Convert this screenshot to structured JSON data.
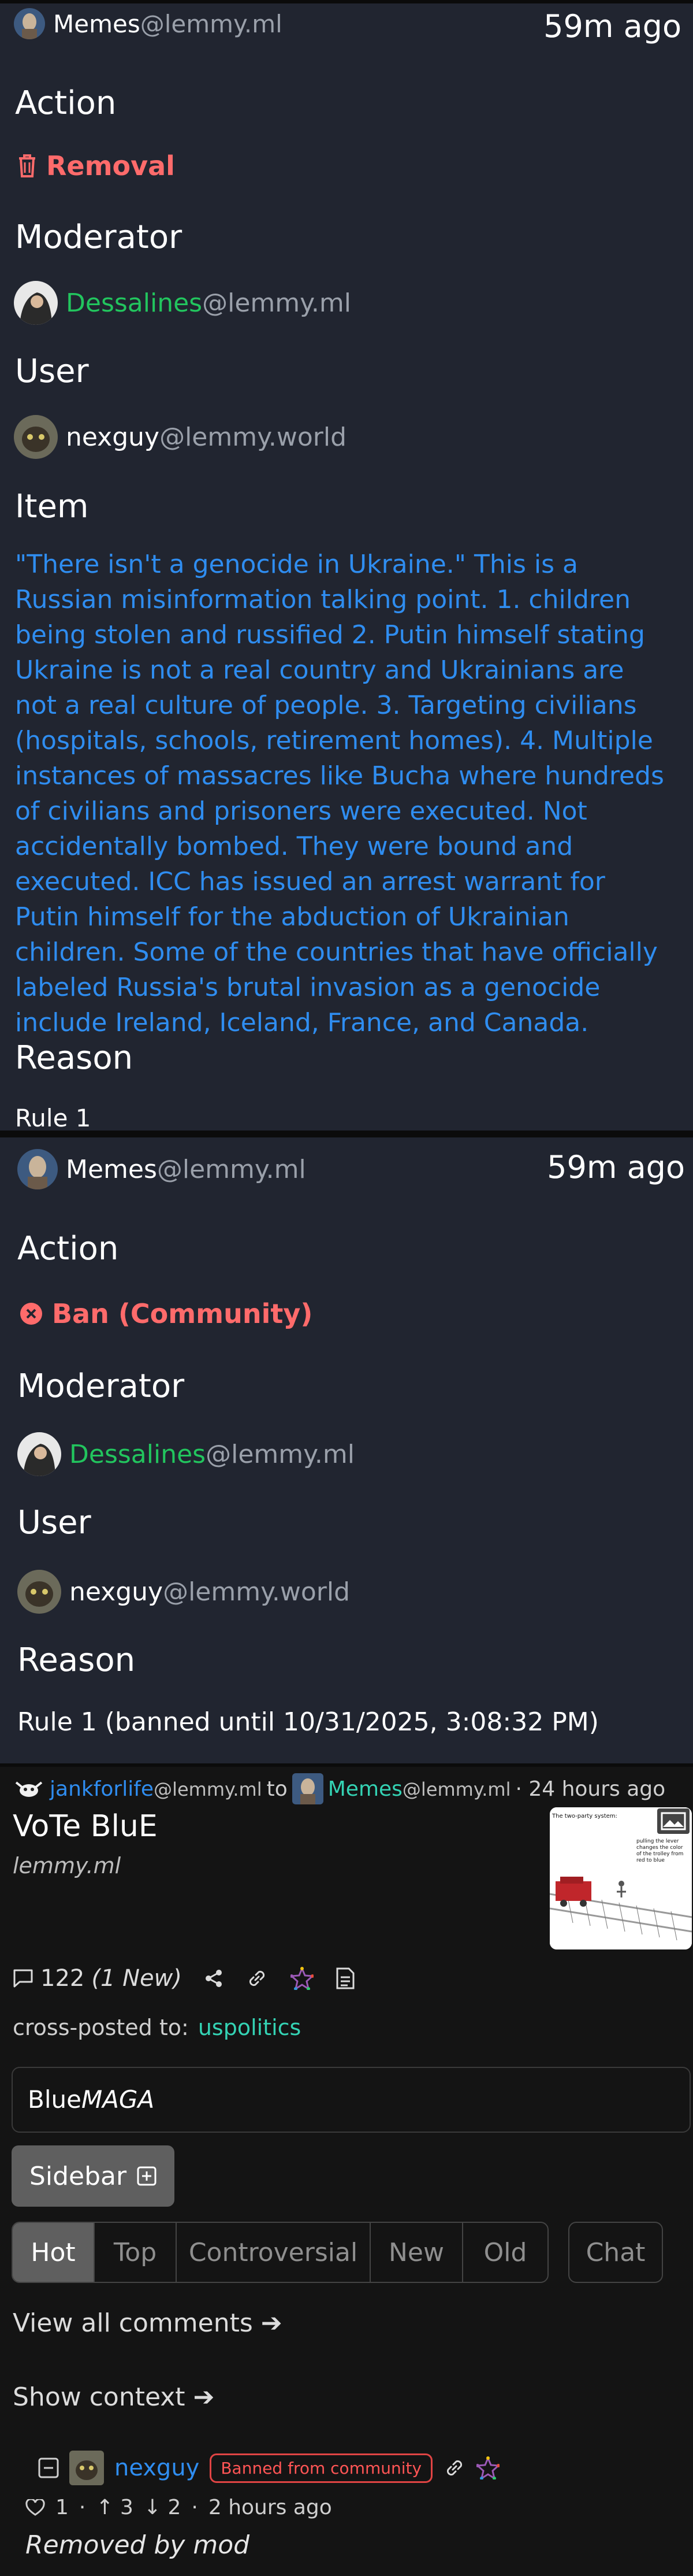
{
  "log_entry_1": {
    "community_name": "Memes",
    "community_instance": "@lemmy.ml",
    "time": "59m ago",
    "action_heading": "Action",
    "action": "Removal",
    "moderator_heading": "Moderator",
    "moderator_name": "Dessalines",
    "moderator_instance": "@lemmy.ml",
    "user_heading": "User",
    "user_name": "nexguy",
    "user_instance": "@lemmy.world",
    "item_heading": "Item",
    "item_text": "\"There isn't a genocide in Ukraine.\" This is a Russian misinformation talking point. 1. children being stolen and russified 2. Putin himself stating Ukraine is not a real country and Ukrainians are not a real culture of people. 3. Targeting civilians (hospitals, schools, retirement homes). 4. Multiple instances of massacres like Bucha where hundreds of civilians and prisoners were executed. Not accidentally bombed. They were bound and executed. ICC has issued an arrest warrant for Putin himself for the abduction of Ukrainian children. Some of the countries that have officially labeled Russia's brutal invasion as a genocide include Ireland, Iceland, France, and Canada.",
    "reason_heading": "Reason",
    "reason": "Rule 1"
  },
  "log_entry_2": {
    "community_name": "Memes",
    "community_instance": "@lemmy.ml",
    "time": "59m ago",
    "action_heading": "Action",
    "action": "Ban (Community)",
    "moderator_heading": "Moderator",
    "moderator_name": "Dessalines",
    "moderator_instance": "@lemmy.ml",
    "user_heading": "User",
    "user_name": "nexguy",
    "user_instance": "@lemmy.world",
    "reason_heading": "Reason",
    "reason": "Rule 1 (banned until 10/31/2025, 3:08:32 PM)"
  },
  "post": {
    "author": "jankforlife",
    "author_instance": "@lemmy.ml",
    "to_word": "to",
    "community": "Memes",
    "community_instance": "@lemmy.ml",
    "time": "· 24 hours ago",
    "title": "VoTe BluE",
    "domain": "lemmy.ml",
    "thumbnail_caption_left": "The two-party system:",
    "thumbnail_caption_right": "pulling the lever changes the color of the trolley from red to blue",
    "comments_count": "122",
    "comments_new": "(1 New)",
    "crosspost_label": "cross-posted to:",
    "crosspost_target": "uspolitics",
    "body_plain": "Blue",
    "body_italic": "MAGA",
    "sidebar_label": "Sidebar",
    "sort_tabs": [
      "Hot",
      "Top",
      "Controversial",
      "New",
      "Old"
    ],
    "chat_label": "Chat",
    "view_all_comments": "View all comments ➔",
    "show_context": "Show context ➔"
  },
  "comment": {
    "author": "nexguy",
    "badge": "Banned from community",
    "likes": "1",
    "upvotes": "3",
    "downvotes": "2",
    "time": "2 hours ago",
    "body": "Removed by mod"
  },
  "colors": {
    "background": "#141414",
    "card": "#212530",
    "removal_red": "#ff6b6b",
    "mod_green": "#22c55e",
    "link_blue": "#2f8df0",
    "teal": "#34d3b4"
  }
}
